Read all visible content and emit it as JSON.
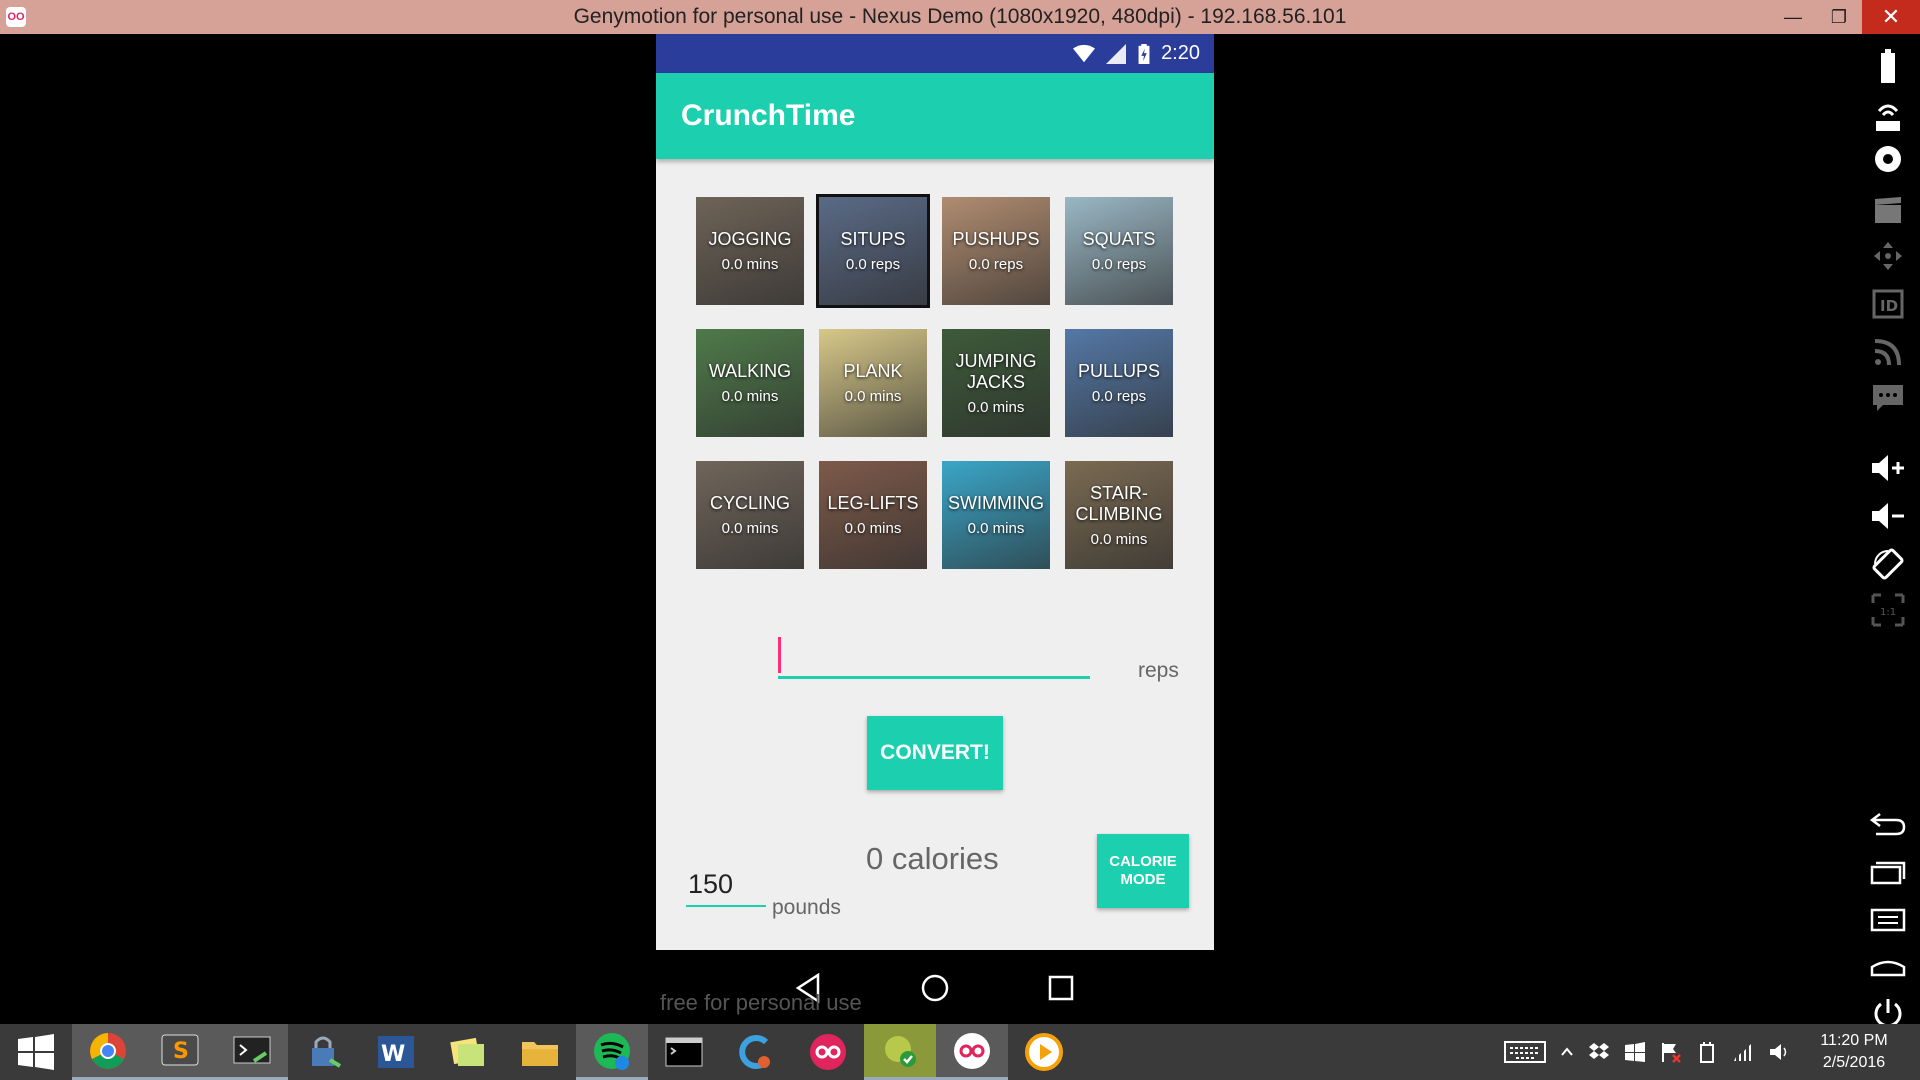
{
  "window": {
    "title": "Genymotion for personal use - Nexus Demo (1080x1920, 480dpi) - 192.168.56.101",
    "logo": "OO",
    "buttons": {
      "minimize": "—",
      "maximize": "❐",
      "close": "✕"
    }
  },
  "statusbar": {
    "time": "2:20",
    "icons": [
      "wifi-icon",
      "signal-icon",
      "battery-charging-icon"
    ]
  },
  "app": {
    "title": "CrunchTime"
  },
  "exercises": [
    {
      "name": "JOGGING",
      "value": "0.0 mins",
      "bg": "#6e6357"
    },
    {
      "name": "SITUPS",
      "value": "0.0 reps",
      "bg": "#5a6a86",
      "selected": true
    },
    {
      "name": "PUSHUPS",
      "value": "0.0 reps",
      "bg": "#b08c70"
    },
    {
      "name": "SQUATS",
      "value": "0.0 reps",
      "bg": "#9ab7c4"
    },
    {
      "name": "WALKING",
      "value": "0.0 mins",
      "bg": "#4f7a4a"
    },
    {
      "name": "PLANK",
      "value": "0.0 mins",
      "bg": "#d7c889"
    },
    {
      "name": "JUMPING JACKS",
      "value": "0.0 mins",
      "bg": "#3d5a3a"
    },
    {
      "name": "PULLUPS",
      "value": "0.0 reps",
      "bg": "#5478a6"
    },
    {
      "name": "CYCLING",
      "value": "0.0 mins",
      "bg": "#70655a"
    },
    {
      "name": "LEG-LIFTS",
      "value": "0.0 mins",
      "bg": "#7d5a4a"
    },
    {
      "name": "SWIMMING",
      "value": "0.0 mins",
      "bg": "#3aa6c8"
    },
    {
      "name": "STAIR-CLIMBING",
      "value": "0.0 mins",
      "bg": "#7a6a52"
    }
  ],
  "input": {
    "value": "",
    "unit": "reps"
  },
  "convert_button": "CONVERT!",
  "calories": "0 calories",
  "weight": {
    "value": "150",
    "unit": "pounds"
  },
  "mode_button": "CALORIE MODE",
  "watermark": "free for personal use",
  "taskbar": {
    "apps": [
      "windows-start-icon",
      "chrome-icon",
      "sublime-text-icon",
      "terminal-app-icon",
      "security-app-icon",
      "word-icon",
      "sticky-notes-icon",
      "file-explorer-icon",
      "spotify-icon",
      "cmd-icon",
      "app-icon",
      "genymotion-icon",
      "check-app-icon",
      "genymotion-active-icon",
      "media-player-icon"
    ],
    "time": "11:20 PM",
    "date": "2/5/2016"
  },
  "colors": {
    "accent": "#1ccfae",
    "statusbar": "#2a3d9a",
    "cursor": "#ff2c7a"
  }
}
